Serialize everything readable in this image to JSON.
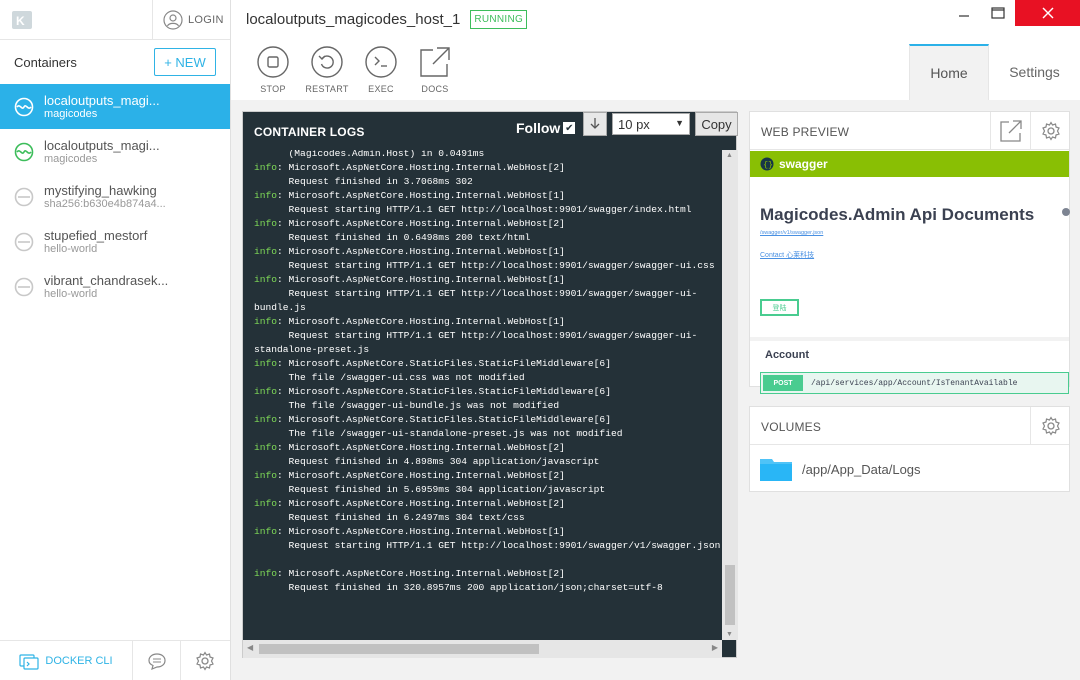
{
  "sidebar": {
    "login_label": "LOGIN",
    "containers_title": "Containers",
    "new_label": "+ NEW",
    "items": [
      {
        "name": "localoutputs_magi...",
        "sub": "magicodes",
        "status": "running",
        "selected": true
      },
      {
        "name": "localoutputs_magi...",
        "sub": "magicodes",
        "status": "running",
        "selected": false
      },
      {
        "name": "mystifying_hawking",
        "sub": "sha256:b630e4b874a4...",
        "status": "stopped",
        "selected": false
      },
      {
        "name": "stupefied_mestorf",
        "sub": "hello-world",
        "status": "stopped",
        "selected": false
      },
      {
        "name": "vibrant_chandrasek...",
        "sub": "hello-world",
        "status": "stopped",
        "selected": false
      }
    ],
    "docker_cli_label": "DOCKER CLI"
  },
  "header": {
    "container_name": "localoutputs_magicodes_host_1",
    "status_badge": "RUNNING",
    "actions": [
      {
        "label": "STOP",
        "icon": "stop-icon"
      },
      {
        "label": "RESTART",
        "icon": "restart-icon"
      },
      {
        "label": "EXEC",
        "icon": "terminal-icon"
      },
      {
        "label": "DOCS",
        "icon": "external-link-icon"
      }
    ],
    "tabs": [
      {
        "label": "Home",
        "active": true
      },
      {
        "label": "Settings",
        "active": false
      }
    ]
  },
  "logs": {
    "title": "CONTAINER LOGS",
    "follow_label": "Follow",
    "follow_checked": true,
    "font_size_value": "10 px",
    "copy_label": "Copy",
    "lines": [
      {
        "kind": "text",
        "text": "      (Magicodes.Admin.Host) in 0.0491ms"
      },
      {
        "kind": "info",
        "src": "Microsoft.AspNetCore.Hosting.Internal.WebHost[2]"
      },
      {
        "kind": "text",
        "text": "      Request finished in 3.7068ms 302"
      },
      {
        "kind": "info",
        "src": "Microsoft.AspNetCore.Hosting.Internal.WebHost[1]"
      },
      {
        "kind": "text",
        "text": "      Request starting HTTP/1.1 GET http://localhost:9901/swagger/index.html"
      },
      {
        "kind": "info",
        "src": "Microsoft.AspNetCore.Hosting.Internal.WebHost[2]"
      },
      {
        "kind": "text",
        "text": "      Request finished in 0.6498ms 200 text/html"
      },
      {
        "kind": "info",
        "src": "Microsoft.AspNetCore.Hosting.Internal.WebHost[1]"
      },
      {
        "kind": "text",
        "text": "      Request starting HTTP/1.1 GET http://localhost:9901/swagger/swagger-ui.css"
      },
      {
        "kind": "info",
        "src": "Microsoft.AspNetCore.Hosting.Internal.WebHost[1]"
      },
      {
        "kind": "text",
        "text": "      Request starting HTTP/1.1 GET http://localhost:9901/swagger/swagger-ui-"
      },
      {
        "kind": "text",
        "text": "bundle.js"
      },
      {
        "kind": "info",
        "src": "Microsoft.AspNetCore.Hosting.Internal.WebHost[1]"
      },
      {
        "kind": "text",
        "text": "      Request starting HTTP/1.1 GET http://localhost:9901/swagger/swagger-ui-"
      },
      {
        "kind": "text",
        "text": "standalone-preset.js"
      },
      {
        "kind": "info",
        "src": "Microsoft.AspNetCore.StaticFiles.StaticFileMiddleware[6]"
      },
      {
        "kind": "text",
        "text": "      The file /swagger-ui.css was not modified"
      },
      {
        "kind": "info",
        "src": "Microsoft.AspNetCore.StaticFiles.StaticFileMiddleware[6]"
      },
      {
        "kind": "text",
        "text": "      The file /swagger-ui-bundle.js was not modified"
      },
      {
        "kind": "info",
        "src": "Microsoft.AspNetCore.StaticFiles.StaticFileMiddleware[6]"
      },
      {
        "kind": "text",
        "text": "      The file /swagger-ui-standalone-preset.js was not modified"
      },
      {
        "kind": "info",
        "src": "Microsoft.AspNetCore.Hosting.Internal.WebHost[2]"
      },
      {
        "kind": "text",
        "text": "      Request finished in 4.898ms 304 application/javascript"
      },
      {
        "kind": "info",
        "src": "Microsoft.AspNetCore.Hosting.Internal.WebHost[2]"
      },
      {
        "kind": "text",
        "text": "      Request finished in 5.6959ms 304 application/javascript"
      },
      {
        "kind": "info",
        "src": "Microsoft.AspNetCore.Hosting.Internal.WebHost[2]"
      },
      {
        "kind": "text",
        "text": "      Request finished in 6.2497ms 304 text/css"
      },
      {
        "kind": "info",
        "src": "Microsoft.AspNetCore.Hosting.Internal.WebHost[1]"
      },
      {
        "kind": "text",
        "text": "      Request starting HTTP/1.1 GET http://localhost:9901/swagger/v1/swagger.json"
      },
      {
        "kind": "text",
        "text": ""
      },
      {
        "kind": "info",
        "src": "Microsoft.AspNetCore.Hosting.Internal.WebHost[2]"
      },
      {
        "kind": "text",
        "text": "      Request finished in 320.8957ms 200 application/json;charset=utf-8"
      }
    ]
  },
  "preview": {
    "title": "WEB PREVIEW",
    "swagger_label": "swagger",
    "api_title": "Magicodes.Admin Api Documents",
    "json_link": "/swagger/v1/swagger.json",
    "contact_link": "Contact 心莱科技",
    "login_button": "登陆",
    "section": "Account",
    "op_method": "POST",
    "op_path": "/api/services/app/Account/IsTenantAvailable"
  },
  "volumes": {
    "title": "VOLUMES",
    "items": [
      {
        "path": "/app/App_Data/Logs"
      }
    ]
  },
  "colors": {
    "accent": "#2bb1e8",
    "running": "#3dbd5b",
    "swagger_green": "#89bf04",
    "logs_bg": "#243138",
    "close_red": "#e81123"
  }
}
